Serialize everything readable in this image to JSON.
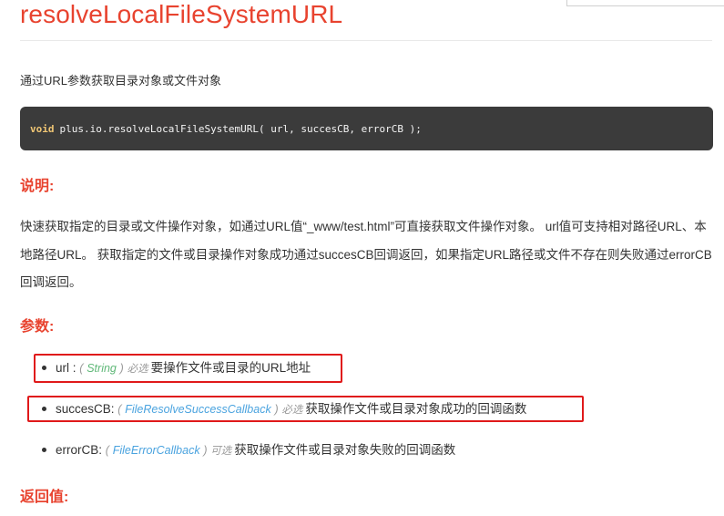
{
  "api": {
    "name": "resolveLocalFileSystemURL",
    "summary": "通过URL参数获取目录对象或文件对象"
  },
  "code": {
    "keyword": "void",
    "signature": "plus.io.resolveLocalFileSystemURL( url, succesCB, errorCB );"
  },
  "sections": {
    "description_heading": "说明:",
    "params_heading": "参数:",
    "return_heading": "返回值:"
  },
  "description": "快速获取指定的目录或文件操作对象，如通过URL值“_www/test.html”可直接获取文件操作对象。 url值可支持相对路径URL、本地路径URL。 获取指定的文件或目录操作对象成功通过succesCB回调返回，如果指定URL路径或文件不存在则失败通过errorCB回调返回。",
  "params": [
    {
      "name": "url :",
      "open": "(",
      "type": "String",
      "close": ")",
      "required": "必选",
      "desc": "要操作文件或目录的URL地址"
    },
    {
      "name": "succesCB:",
      "open": "(",
      "type": "FileResolveSuccessCallback",
      "close": ")",
      "required": "必选",
      "desc": "获取操作文件或目录对象成功的回调函数"
    },
    {
      "name": "errorCB:",
      "open": "(",
      "type": "FileErrorCallback",
      "close": ")",
      "required": "可选",
      "desc": "获取操作文件或目录对象失败的回调函数"
    }
  ],
  "colors": {
    "heading": "#e8432f",
    "highlight": "#e0191a",
    "code_bg": "#3b3b3b"
  }
}
